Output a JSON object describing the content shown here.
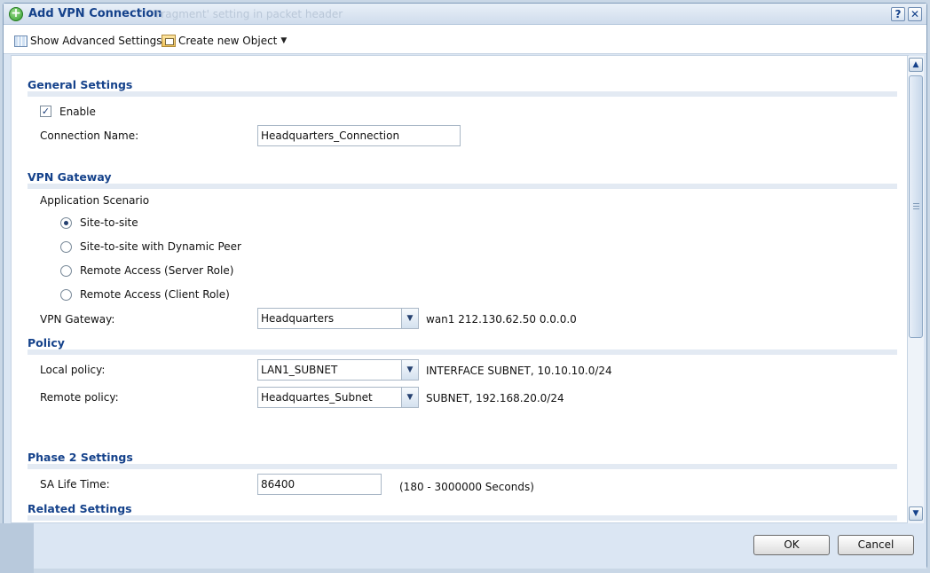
{
  "window": {
    "title": "Add VPN Connection",
    "ghost_text": "'Fragment' setting in packet header"
  },
  "toolbar": {
    "show_advanced": "Show Advanced Settings",
    "create_object": "Create new Object"
  },
  "general": {
    "heading": "General Settings",
    "enable_label": "Enable",
    "enable_checked": "✓",
    "connection_name_label": "Connection Name:",
    "connection_name_value": "Headquarters_Connection"
  },
  "vpn_gateway": {
    "heading": "VPN Gateway",
    "scenario_label": "Application Scenario",
    "scenarios": [
      "Site-to-site",
      "Site-to-site with Dynamic Peer",
      "Remote Access (Server Role)",
      "Remote Access (Client Role)"
    ],
    "gateway_label": "VPN Gateway:",
    "gateway_value": "Headquarters",
    "gateway_info": "wan1 212.130.62.50 0.0.0.0"
  },
  "policy": {
    "heading": "Policy",
    "local_label": "Local policy:",
    "local_value": "LAN1_SUBNET",
    "local_info": "INTERFACE SUBNET, 10.10.10.0/24",
    "remote_label": "Remote policy:",
    "remote_value": "Headquartes_Subnet",
    "remote_info": "SUBNET, 192.168.20.0/24"
  },
  "phase2": {
    "heading": "Phase 2 Settings",
    "sa_label": "SA Life Time:",
    "sa_value": "86400",
    "sa_range": "(180 - 3000000 Seconds)"
  },
  "related": {
    "heading": "Related Settings"
  },
  "footer": {
    "ok": "OK",
    "cancel": "Cancel"
  },
  "titlebar_buttons": {
    "help": "?",
    "close": "✕"
  }
}
